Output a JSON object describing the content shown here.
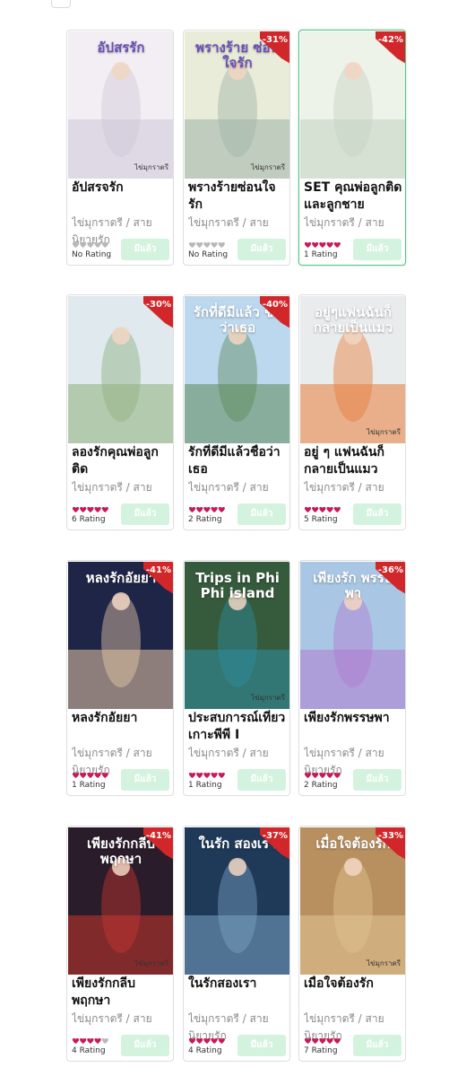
{
  "button_label": "มีแล้ว",
  "colors": {
    "accent_green": "#55c08a",
    "ribbon_red": "#d1272a",
    "star_pink": "#c81a5a",
    "star_grey": "#b8b8b8",
    "button_bg": "#d4f3df"
  },
  "books": [
    {
      "title": "อัปสรจรัก",
      "subtitle": "ไข่มุกราตรี / สาย นิยายรัก",
      "rating_label": "No Rating",
      "stars_filled": 0,
      "discount": "",
      "cover_title": "อัปสรรัก",
      "cover_author": "ไข่มุกราตรี",
      "selected": false,
      "palette": [
        "#f2eef4",
        "#cfc8d8"
      ]
    },
    {
      "title": "พรางร้ายซ่อนใจรัก",
      "subtitle": "ไข่มุกราตรี / สาย",
      "rating_label": "No Rating",
      "stars_filled": 0,
      "discount": "-31%",
      "cover_title": "พรางร้าย ซ่อนใจรัก",
      "cover_author": "ไข่มุกราตรี",
      "selected": false,
      "palette": [
        "#e8ecd8",
        "#9fb3a8"
      ]
    },
    {
      "title": "SET คุณพ่อลูกติดและลูกชาย",
      "subtitle": "ไข่มุกราตรี / สาย",
      "rating_label": "1 Rating",
      "stars_filled": 5,
      "discount": "-42%",
      "cover_title": "",
      "cover_author": "",
      "selected": true,
      "palette": [
        "#eef3ea",
        "#c4d2c0"
      ]
    },
    {
      "title": "ลองรักคุณพ่อลูกติด",
      "subtitle": "ไข่มุกราตรี / สาย",
      "rating_label": "6 Rating",
      "stars_filled": 5,
      "discount": "-30%",
      "cover_title": "",
      "cover_author": "",
      "selected": false,
      "palette": [
        "#dfe9ee",
        "#8fb07c"
      ]
    },
    {
      "title": "รักที่ดีมีแล้วชื่อว่าเธอ",
      "subtitle": "ไข่มุกราตรี / สาย",
      "rating_label": "2 Rating",
      "stars_filled": 5,
      "discount": "-40%",
      "cover_title": "รักที่ดีมีแล้ว ชื่อว่าเธอ",
      "cover_author": "",
      "selected": false,
      "palette": [
        "#bcd8ee",
        "#5d8a5a"
      ]
    },
    {
      "title": "อยู่ ๆ แฟนฉันก็กลายเป็นแมว",
      "subtitle": "ไข่มุกราตรี / สาย",
      "rating_label": "5 Rating",
      "stars_filled": 5,
      "discount": "",
      "cover_title": "อยู่ๆแฟนฉันก็กลายเป็นแมว",
      "cover_author": "ไข่มุกราตรี",
      "selected": false,
      "palette": [
        "#e9ecec",
        "#e77d3a"
      ]
    },
    {
      "title": "หลงรักอัยยา",
      "subtitle": "ไข่มุกราตรี / สาย นิยายรัก",
      "rating_label": "1 Rating",
      "stars_filled": 5,
      "discount": "-41%",
      "cover_title": "หลงรักอัยยา",
      "cover_author": "",
      "selected": false,
      "palette": [
        "#1f2547",
        "#e8c9a6"
      ]
    },
    {
      "title": "ประสบการณ์เที่ยวเกาะพีพี I",
      "subtitle": "ไข่มุกราตรี / สาย",
      "rating_label": "1 Rating",
      "stars_filled": 5,
      "discount": "",
      "cover_title": "Trips in Phi Phi island",
      "cover_author": "ไข่มุกราตรี",
      "selected": false,
      "palette": [
        "#365a3c",
        "#2f8fa0"
      ]
    },
    {
      "title": "เพียงรักพรรษพา",
      "subtitle": "ไข่มุกราตรี / สาย นิยายรัก",
      "rating_label": "2 Rating",
      "stars_filled": 5,
      "discount": "-36%",
      "cover_title": "เพียงรัก พรรษพา",
      "cover_author": "",
      "selected": false,
      "palette": [
        "#a9c7e4",
        "#b07ad0"
      ]
    },
    {
      "title": "เพียงรักกลีบพฤกษา",
      "subtitle": "ไข่มุกราตรี / สาย",
      "rating_label": "4 Rating",
      "stars_filled": 4,
      "discount": "-41%",
      "cover_title": "เพียงรักกลีบพฤกษา",
      "cover_author": "ไข่มุกราตรี",
      "selected": false,
      "palette": [
        "#2a1c2a",
        "#c8362e"
      ]
    },
    {
      "title": "ในรักสองเรา",
      "subtitle": "ไข่มุกราตรี / สาย นิยายรัก",
      "rating_label": "4 Rating",
      "stars_filled": 5,
      "discount": "-37%",
      "cover_title": "ในรัก สองเรา",
      "cover_author": "",
      "selected": false,
      "palette": [
        "#1e3a58",
        "#7aa2c4"
      ]
    },
    {
      "title": "เมื่อใจต้องรัก",
      "subtitle": "ไข่มุกราตรี / สาย นิยายรัก",
      "rating_label": "7 Rating",
      "stars_filled": 5,
      "discount": "-33%",
      "cover_title": "เมื่อใจต้องรัก",
      "cover_author": "ไข่มุกราตรี",
      "selected": false,
      "palette": [
        "#b89060",
        "#e3c493"
      ]
    }
  ]
}
